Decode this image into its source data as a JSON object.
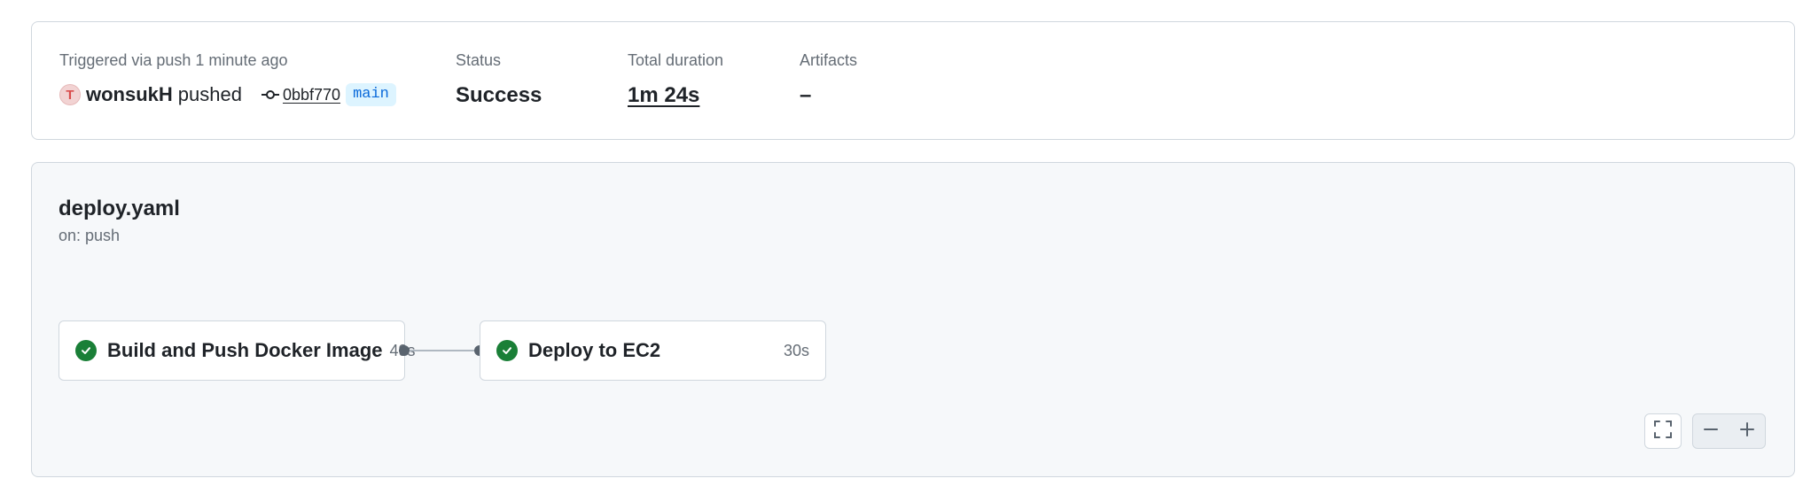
{
  "summary": {
    "trigger_label": "Triggered via push 1 minute ago",
    "avatar_initial": "T",
    "user": "wonsukH",
    "action": "pushed",
    "commit_sha": "0bbf770",
    "branch": "main",
    "status_label": "Status",
    "status_value": "Success",
    "duration_label": "Total duration",
    "duration_value": "1m 24s",
    "artifacts_label": "Artifacts",
    "artifacts_value": "–"
  },
  "workflow": {
    "file": "deploy.yaml",
    "trigger": "on: push",
    "jobs": [
      {
        "name": "Build and Push Docker Image",
        "duration": "49s",
        "status": "success"
      },
      {
        "name": "Deploy to EC2",
        "duration": "30s",
        "status": "success"
      }
    ]
  },
  "colors": {
    "success": "#1a7f37",
    "branch_bg": "#ddf4ff",
    "branch_text": "#0969da"
  },
  "icons": [
    "commit-icon",
    "check-circle-icon",
    "fullscreen-icon",
    "zoom-out-icon",
    "zoom-in-icon"
  ]
}
